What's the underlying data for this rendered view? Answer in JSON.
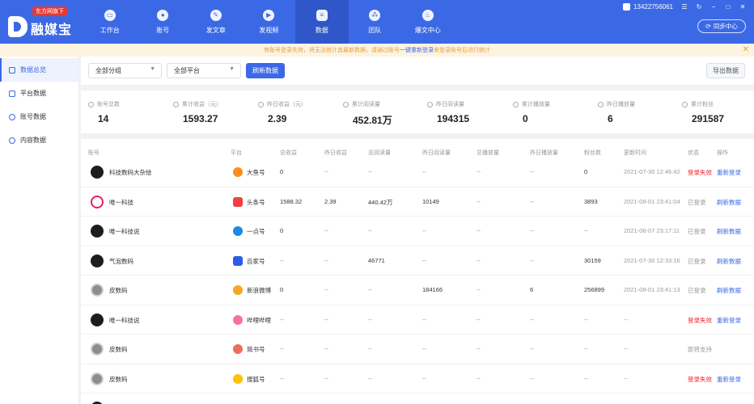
{
  "app": {
    "badge": "东方网旗下",
    "name": "融媒宝"
  },
  "nav": [
    {
      "label": "工作台",
      "icon": "monitor-icon"
    },
    {
      "label": "账号",
      "icon": "user-icon"
    },
    {
      "label": "发文章",
      "icon": "feather-icon"
    },
    {
      "label": "发视频",
      "icon": "video-icon"
    },
    {
      "label": "数据",
      "icon": "data-icon"
    },
    {
      "label": "团队",
      "icon": "team-icon"
    },
    {
      "label": "爆文中心",
      "icon": "fire-icon"
    }
  ],
  "user": {
    "phone": "13422756061",
    "sync_label": "同步中心"
  },
  "notice": {
    "text_before": "有账号登录失效，将无法统计其最新数据，请通过账号",
    "link": "一键重新登录",
    "text_after": "来登录账号后进行统计"
  },
  "sidebar": [
    {
      "label": "数据总览"
    },
    {
      "label": "平台数据"
    },
    {
      "label": "账号数据"
    },
    {
      "label": "内容数据"
    }
  ],
  "filters": {
    "group": "全部分组",
    "platform": "全部平台",
    "refresh": "刷新数据",
    "export": "导出数据"
  },
  "stats": [
    {
      "label": "账号总数",
      "value": "14"
    },
    {
      "label": "累计收益（元）",
      "value": "1593.27"
    },
    {
      "label": "昨日收益（元）",
      "value": "2.39"
    },
    {
      "label": "累计阅读量",
      "value": "452.81万"
    },
    {
      "label": "昨日阅读量",
      "value": "194315"
    },
    {
      "label": "累计播放量",
      "value": "0"
    },
    {
      "label": "昨日播放量",
      "value": "6"
    },
    {
      "label": "累计粉丝",
      "value": "291587"
    }
  ],
  "table": {
    "headers": [
      "账号",
      "平台",
      "总收益",
      "昨日收益",
      "总阅读量",
      "昨日阅读量",
      "总播放量",
      "昨日播放量",
      "粉丝数",
      "更新时间",
      "状态",
      "操作"
    ],
    "rows": [
      {
        "name": "科技数码大杂烩",
        "platform": "大鱼号",
        "total_income": "0",
        "yesterday_income": "--",
        "total_read": "--",
        "yesterday_read": "--",
        "total_play": "--",
        "yesterday_play": "--",
        "fans": "0",
        "time": "2021-07-30 12:46:42",
        "status": "登录失效",
        "action": "重新登录"
      },
      {
        "name": "唯一科技",
        "platform": "头条号",
        "total_income": "1588.32",
        "yesterday_income": "2.39",
        "total_read": "440.42万",
        "yesterday_read": "10149",
        "total_play": "--",
        "yesterday_play": "--",
        "fans": "3893",
        "time": "2021-08-01 23:41:04",
        "status": "已登录",
        "action": "刷新数据"
      },
      {
        "name": "唯一科技说",
        "platform": "一点号",
        "total_income": "0",
        "yesterday_income": "--",
        "total_read": "--",
        "yesterday_read": "--",
        "total_play": "--",
        "yesterday_play": "--",
        "fans": "--",
        "time": "2021-06-07 23:17:11",
        "status": "已登录",
        "action": "刷新数据"
      },
      {
        "name": "气泡数码",
        "platform": "百家号",
        "total_income": "--",
        "yesterday_income": "--",
        "total_read": "46771",
        "yesterday_read": "--",
        "total_play": "--",
        "yesterday_play": "--",
        "fans": "30159",
        "time": "2021-07-30 12:33:16",
        "status": "已登录",
        "action": "刷新数据"
      },
      {
        "name": "皮数码",
        "platform": "新浪微博",
        "total_income": "0",
        "yesterday_income": "--",
        "total_read": "--",
        "yesterday_read": "184166",
        "total_play": "--",
        "yesterday_play": "6",
        "fans": "256899",
        "time": "2021-08-01 23:41:13",
        "status": "已登录",
        "action": "刷新数据"
      },
      {
        "name": "唯一科技说",
        "platform": "哔哩哔哩",
        "total_income": "--",
        "yesterday_income": "--",
        "total_read": "--",
        "yesterday_read": "--",
        "total_play": "--",
        "yesterday_play": "--",
        "fans": "--",
        "time": "--",
        "status": "登录失效",
        "action": "重新登录"
      },
      {
        "name": "皮数码",
        "platform": "简书号",
        "total_income": "--",
        "yesterday_income": "--",
        "total_read": "--",
        "yesterday_read": "--",
        "total_play": "--",
        "yesterday_play": "--",
        "fans": "--",
        "time": "--",
        "status": "即将支持",
        "action": ""
      },
      {
        "name": "皮数码",
        "platform": "搜狐号",
        "total_income": "--",
        "yesterday_income": "--",
        "total_read": "--",
        "yesterday_read": "--",
        "total_play": "--",
        "yesterday_play": "--",
        "fans": "--",
        "time": "--",
        "status": "登录失效",
        "action": "重新登录"
      }
    ]
  },
  "colors": {
    "primary": "#3b69e6",
    "fail": "#f5222d",
    "notice": "#e6a23c"
  }
}
